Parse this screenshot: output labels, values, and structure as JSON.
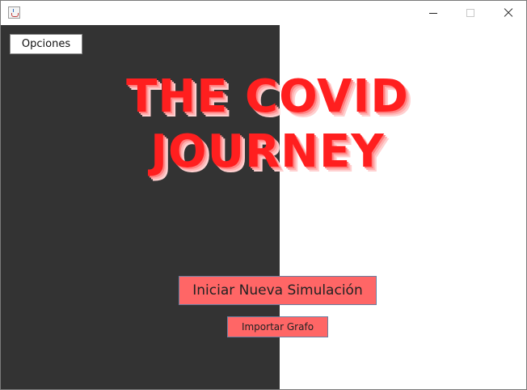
{
  "window": {
    "icon": "java-icon",
    "controls": [
      "minimize-icon",
      "maximize-icon",
      "close-icon"
    ]
  },
  "toolbar": {
    "options_label": "Opciones"
  },
  "title": {
    "line1": "THE COVID",
    "line2": "JOURNEY",
    "color": "#ff1f1f"
  },
  "actions": {
    "start_simulation_label": "Iniciar Nueva Simulación",
    "import_graph_label": "Importar Grafo",
    "button_color": "#ff6666"
  },
  "panel": {
    "dark_color": "#333333"
  }
}
